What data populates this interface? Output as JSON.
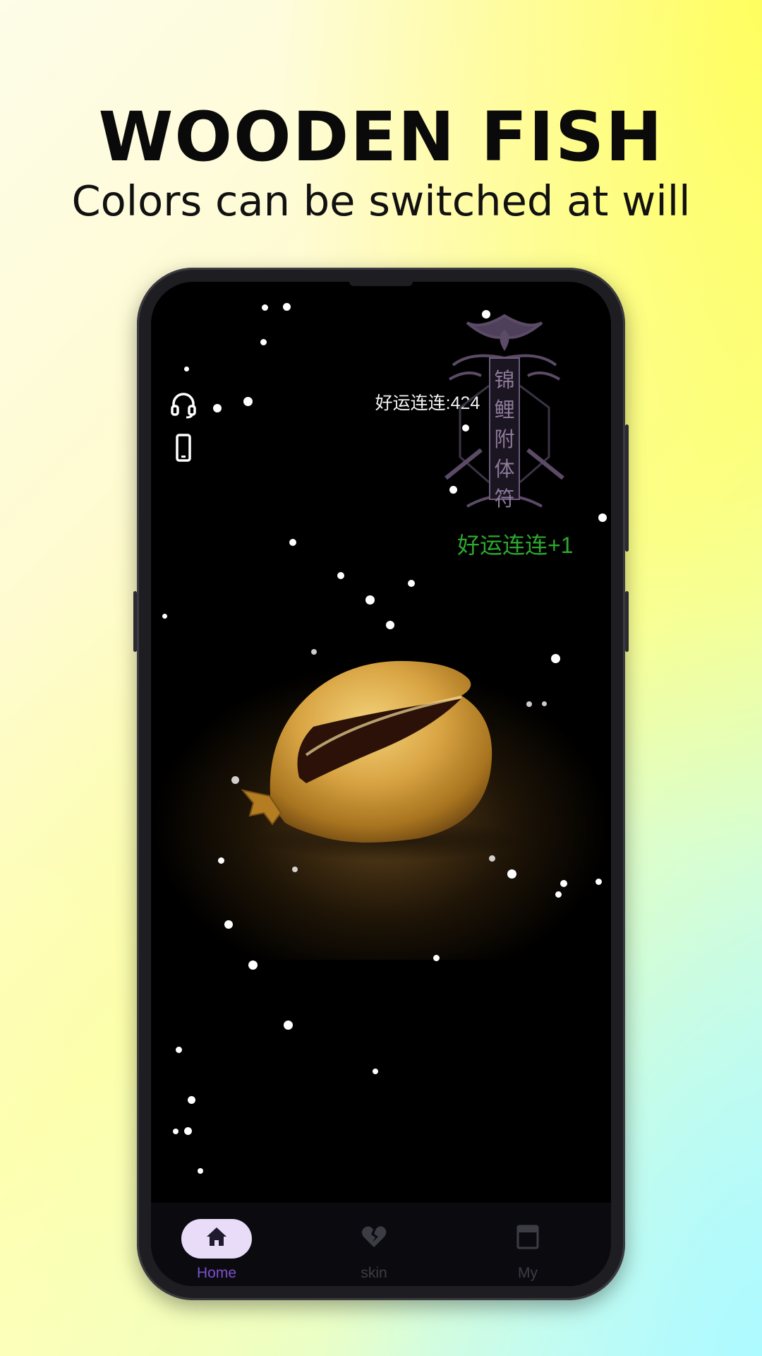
{
  "promo": {
    "title": "WOODEN FISH",
    "subtitle": "Colors can be switched at will"
  },
  "screen": {
    "counter_text": "好运连连:424",
    "merit_popup": "好运连连+1",
    "talisman_text": "锦鲤附体符"
  },
  "nav": {
    "items": [
      {
        "label": "Home",
        "icon": "home-icon",
        "active": true
      },
      {
        "label": "skin",
        "icon": "broken-heart-icon",
        "active": false
      },
      {
        "label": "My",
        "icon": "window-icon",
        "active": false
      }
    ]
  },
  "colors": {
    "popup_green": "#2ea82e",
    "active_nav": "#7b4fd0",
    "inactive_nav": "#3c3c44",
    "fish_gold": "#c99a3a"
  }
}
